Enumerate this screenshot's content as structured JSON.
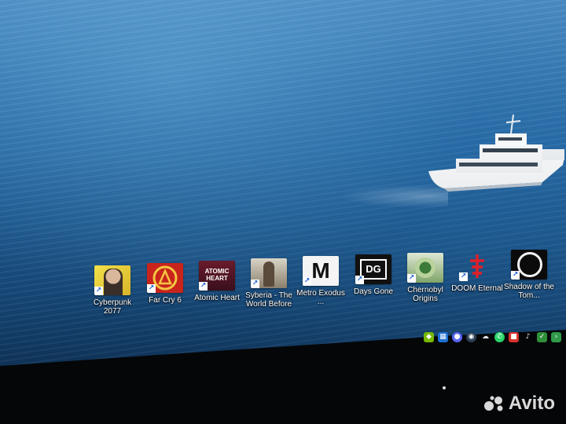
{
  "desktop": {
    "icons": [
      {
        "label": "Cyberpunk 2077",
        "icon": "cyberpunk-icon"
      },
      {
        "label": "Far Cry 6",
        "icon": "farcry-icon"
      },
      {
        "label": "Atomic Heart",
        "icon": "atomic-heart-icon",
        "tile_text": "ATOMIC HEART"
      },
      {
        "label": "Syberia - The World Before",
        "icon": "syberia-icon"
      },
      {
        "label": "Metro Exodus ...",
        "icon": "metro-icon",
        "tile_text": "M"
      },
      {
        "label": "Days Gone",
        "icon": "days-gone-icon",
        "tile_text": "DG"
      },
      {
        "label": "Chernobyl Origins",
        "icon": "chernobyl-icon"
      },
      {
        "label": "DOOM Eternal",
        "icon": "doom-icon"
      },
      {
        "label": "Shadow of the Tom...",
        "icon": "shadow-tomb-icon"
      }
    ],
    "shortcut_glyph": "↗"
  },
  "tray": {
    "icons": [
      "nvidia-icon",
      "network-icon",
      "discord-icon",
      "steam-icon",
      "cloud-icon",
      "whatsapp-icon",
      "security-icon",
      "speaker-icon",
      "shield-icon",
      "chevron-icon"
    ]
  },
  "watermark": {
    "text": "Avito"
  },
  "colors": {
    "sea": "#2c71ae",
    "label_text": "#ffffff",
    "bezel": "#050608"
  }
}
